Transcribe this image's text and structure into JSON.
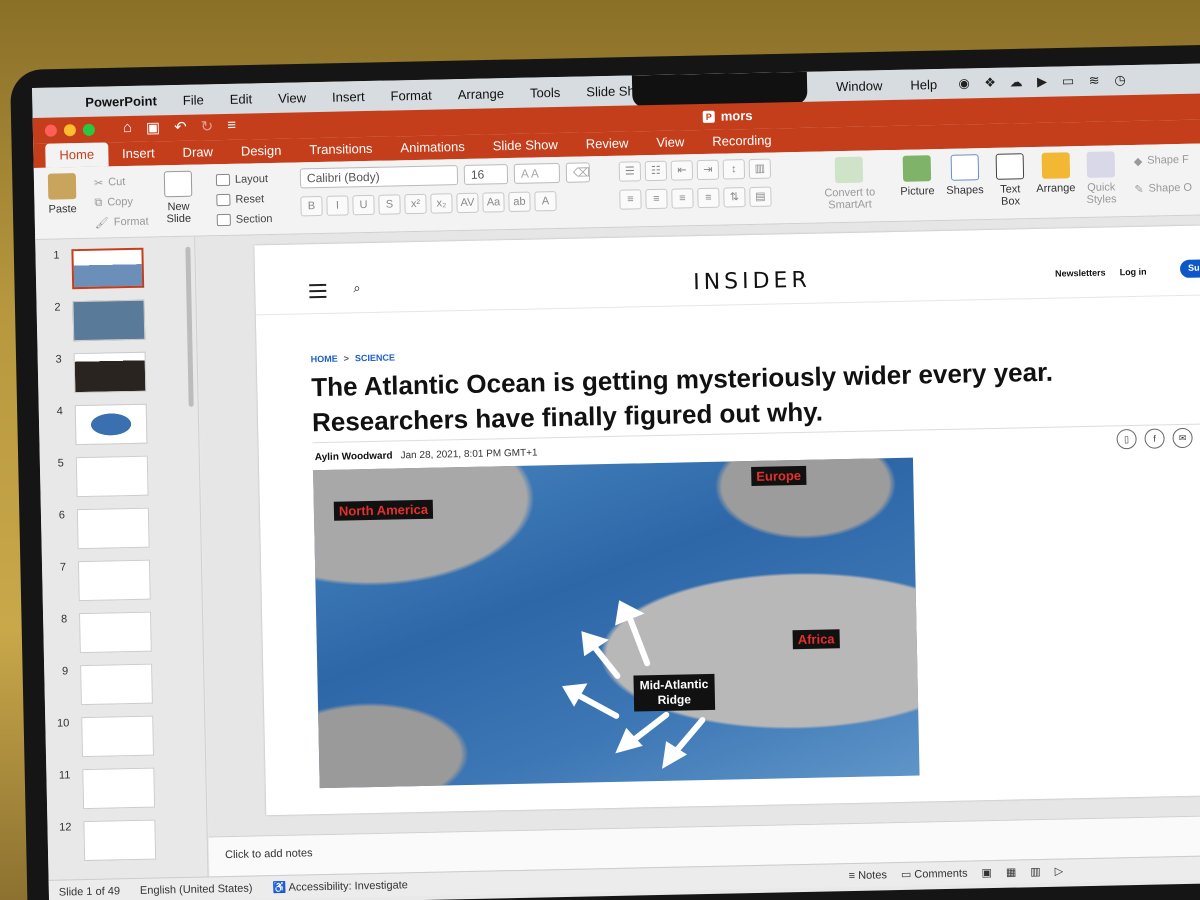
{
  "menubar": {
    "app": "PowerPoint",
    "items": [
      "File",
      "Edit",
      "View",
      "Insert",
      "Format",
      "Arrange",
      "Tools",
      "Slide Show"
    ],
    "right_items": [
      "Window",
      "Help"
    ]
  },
  "window": {
    "title": "mors"
  },
  "ribbon": {
    "tabs": [
      "Home",
      "Insert",
      "Draw",
      "Design",
      "Transitions",
      "Animations",
      "Slide Show",
      "Review",
      "View",
      "Recording"
    ],
    "active_tab": "Home",
    "clipboard": {
      "paste": "Paste",
      "cut": "Cut",
      "copy": "Copy",
      "format": "Format"
    },
    "slides": {
      "new_slide": "New\nSlide",
      "layout": "Layout",
      "reset": "Reset",
      "section": "Section"
    },
    "font": {
      "name": "Calibri (Body)",
      "size": "16"
    },
    "convert": "Convert to\nSmartArt",
    "picture": "Picture",
    "shapes": "Shapes",
    "text_box": "Text\nBox",
    "arrange": "Arrange",
    "quick_styles": "Quick\nStyles",
    "shape_fill": "Shape F",
    "shape_outline": "Shape O"
  },
  "thumbnails": [
    "1",
    "2",
    "3",
    "4",
    "5",
    "6",
    "7",
    "8",
    "9",
    "10",
    "11",
    "12"
  ],
  "selected_slide": 1,
  "slide": {
    "logo": "INSIDER",
    "newsletters": "Newsletters",
    "login": "Log in",
    "subscribe": "Sub",
    "breadcrumb": {
      "home": "HOME",
      "sep": ">",
      "section": "SCIENCE"
    },
    "headline": "The Atlantic Ocean is getting mysteriously wider every year. Researchers have finally figured out why.",
    "author": "Aylin Woodward",
    "date": "Jan 28, 2021, 8:01 PM GMT+1",
    "map_labels": {
      "north_america": "North America",
      "europe": "Europe",
      "africa": "Africa",
      "ridge_line1": "Mid-Atlantic",
      "ridge_line2": "Ridge"
    }
  },
  "notes_placeholder": "Click to add notes",
  "status": {
    "slide_count": "Slide 1 of 49",
    "language": "English (United States)",
    "accessibility": "Accessibility: Investigate",
    "notes": "Notes",
    "comments": "Comments"
  }
}
